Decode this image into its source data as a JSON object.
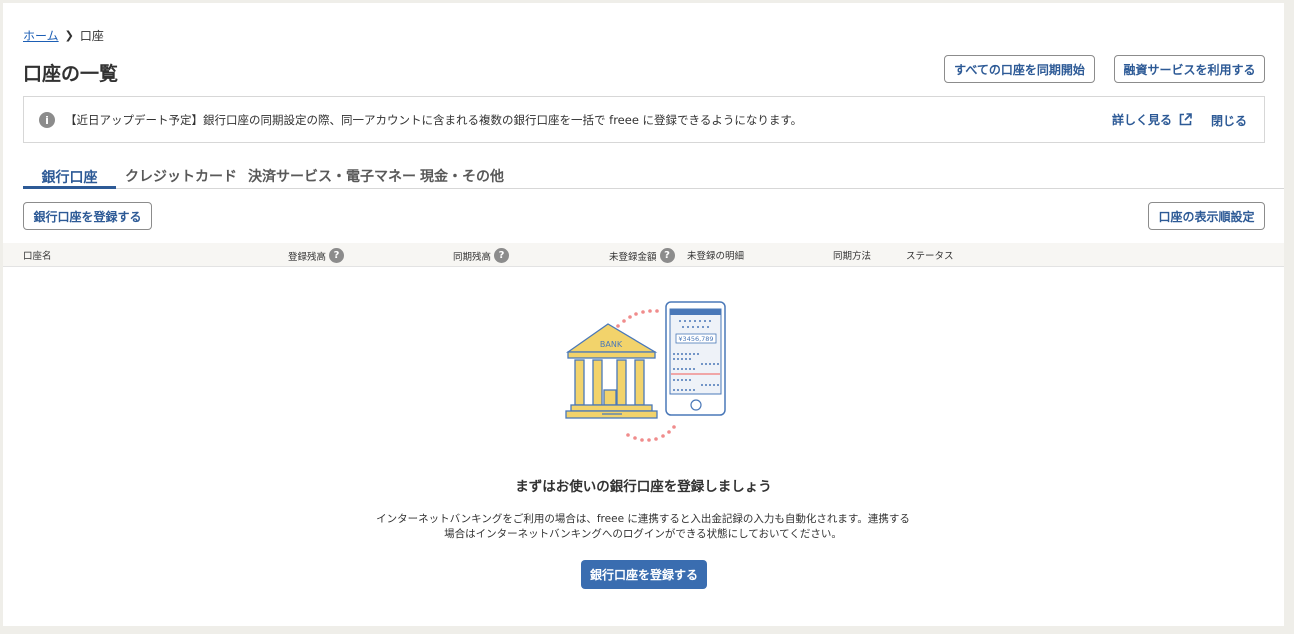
{
  "breadcrumb": {
    "home": "ホーム",
    "current": "口座"
  },
  "page": {
    "title": "口座の一覧"
  },
  "header_buttons": {
    "sync_all": "すべての口座を同期開始",
    "loan_service": "融資サービスを利用する"
  },
  "notice": {
    "text": "【近日アップデート予定】銀行口座の同期設定の際、同一アカウントに含まれる複数の銀行口座を一括で freee に登録できるようになります。",
    "more": "詳しく見る",
    "close": "閉じる"
  },
  "tabs": [
    {
      "label": "銀行口座",
      "active": true
    },
    {
      "label": "クレジットカード"
    },
    {
      "label": "決済サービス・電子マネー"
    },
    {
      "label": "現金・その他"
    }
  ],
  "actions": {
    "register": "銀行口座を登録する",
    "display_order": "口座の表示順設定"
  },
  "table": {
    "columns": {
      "name": "口座名",
      "registered_balance": "登録残高",
      "synced_balance": "同期残高",
      "unregistered_amount": "未登録金額",
      "unregistered_details": "未登録の明細",
      "sync_method": "同期方法",
      "status": "ステータス"
    },
    "help": "?"
  },
  "illustration": {
    "bank_sign": "BANK",
    "phone_amount": "¥3456,789"
  },
  "empty": {
    "title": "まずはお使いの銀行口座を登録しましょう",
    "desc_line1": "インターネットバンキングをご利用の場合は、freee に連携すると入出金記録の入力も自動化されます。連携する",
    "desc_line2": "場合はインターネットバンキングへのログインができる状態にしておいてください。",
    "button": "銀行口座を登録する"
  },
  "colors": {
    "accent": "#2d5a96",
    "primary_button": "#3a6db0",
    "illustration_yellow": "#f2d36b",
    "illustration_blue": "#4a78b8",
    "dots": "#f08c8c"
  }
}
